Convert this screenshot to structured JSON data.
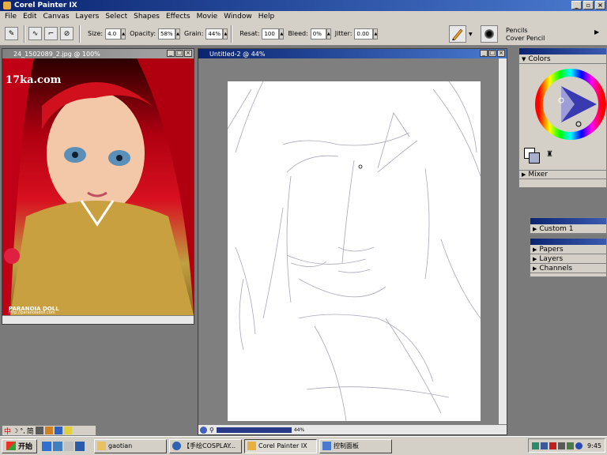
{
  "app": {
    "title": "Corel Painter IX"
  },
  "menu": [
    "File",
    "Edit",
    "Canvas",
    "Layers",
    "Select",
    "Shapes",
    "Effects",
    "Movie",
    "Window",
    "Help"
  ],
  "property_bar": {
    "size_label": "Size:",
    "size_value": "4.0",
    "opacity_label": "Opacity:",
    "opacity_value": "58%",
    "grain_label": "Grain:",
    "grain_value": "44%",
    "resat_label": "Resat:",
    "resat_value": "100",
    "bleed_label": "Bleed:",
    "bleed_value": "0%",
    "jitter_label": "Jitter:",
    "jitter_value": "0.00"
  },
  "brush_selector": {
    "category": "Pencils",
    "variant": "Cover Pencil"
  },
  "reference_window": {
    "title": "24_1502089_2.jpg @ 100%",
    "watermark": "17ka.com",
    "caption1": "PARANOIA DOLL",
    "caption2": "http://paranoiadoll.com"
  },
  "canvas_window": {
    "title": "Untitled-2 @ 44%",
    "zoom": "44%"
  },
  "colors_panel": {
    "title": "Colors",
    "mixer": "Mixer"
  },
  "custom_panel": {
    "title": "Custom 1"
  },
  "palettes": [
    "Papers",
    "Layers",
    "Channels"
  ],
  "taskbar": {
    "start": "开始",
    "buttons": [
      "gaotian",
      "【手绘COSPLAY...",
      "Corel Painter IX",
      "控制面板"
    ],
    "clock": "9:45"
  },
  "ime": [
    "中",
    "☽",
    "°,",
    "简"
  ],
  "colors": {
    "accent": "#0a2470",
    "hue_ring": "#ff0000"
  }
}
